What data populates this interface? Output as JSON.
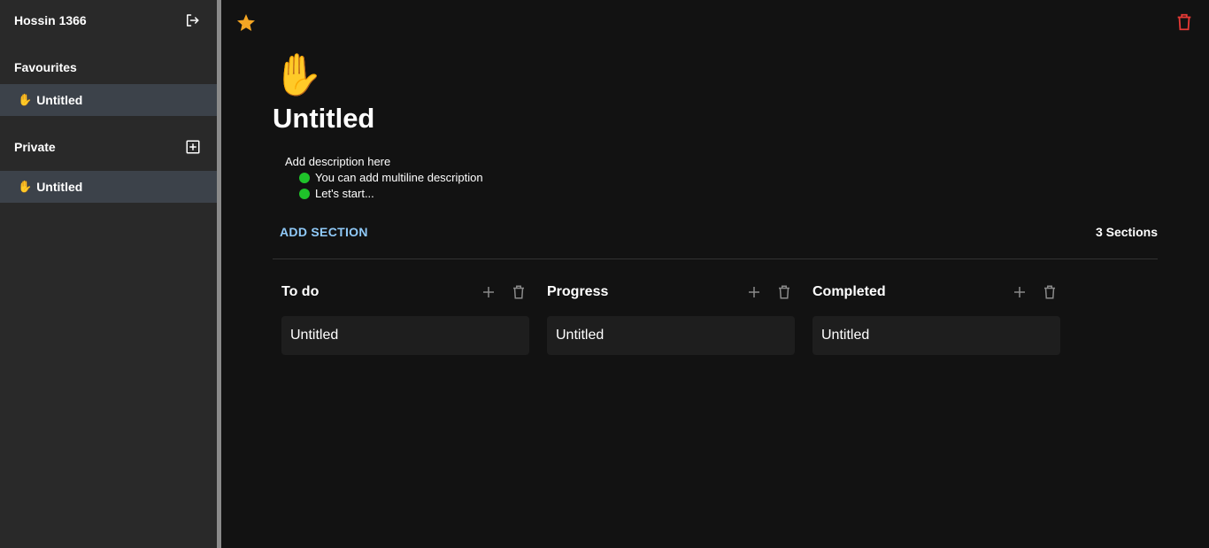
{
  "sidebar": {
    "username": "Hossin 1366",
    "favourites_title": "Favourites",
    "private_title": "Private",
    "favourites": [
      {
        "emoji": "✋",
        "label": "Untitled"
      }
    ],
    "private": [
      {
        "emoji": "✋",
        "label": "Untitled"
      }
    ]
  },
  "board": {
    "emoji": "✋",
    "title": "Untitled",
    "description": {
      "line": "Add description here",
      "bullets": [
        "You can add multiline description",
        "Let's start..."
      ]
    },
    "add_section_label": "ADD SECTION",
    "section_count": "3 Sections",
    "sections": [
      {
        "title": "To do",
        "cards": [
          "Untitled"
        ]
      },
      {
        "title": "Progress",
        "cards": [
          "Untitled"
        ]
      },
      {
        "title": "Completed",
        "cards": [
          "Untitled"
        ]
      }
    ]
  },
  "colors": {
    "favourite_star": "#f5a623",
    "delete_icon": "#e53935",
    "link_accent": "#90caf9",
    "bullet_dot": "#1fc22a"
  }
}
